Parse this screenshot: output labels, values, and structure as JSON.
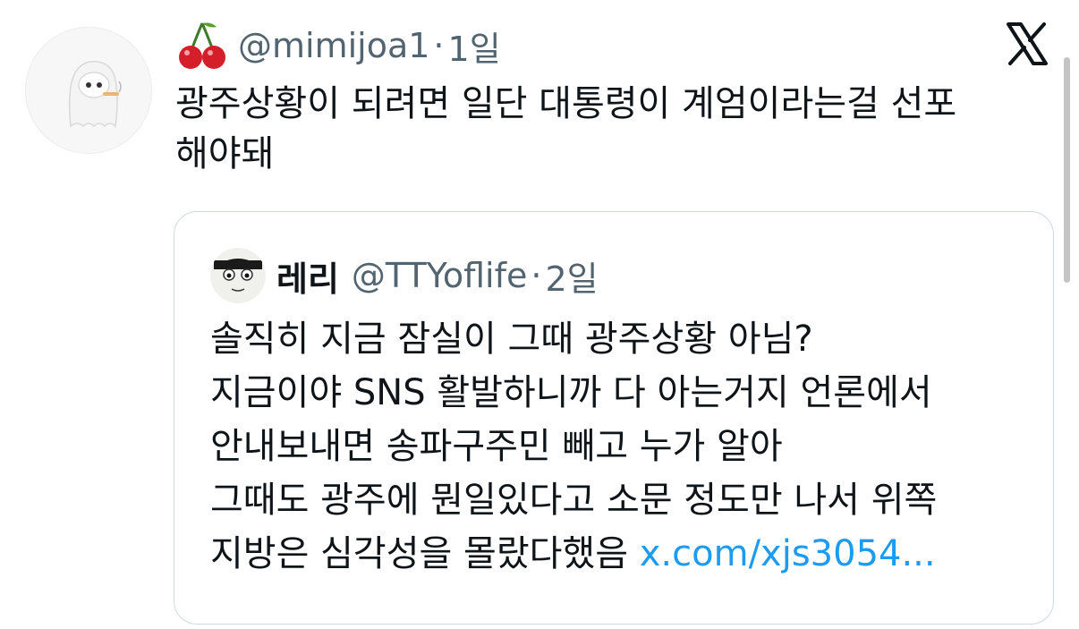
{
  "tweet": {
    "author_handle": "@mimijoa1",
    "separator": "·",
    "time": "1일",
    "text_lines": [
      "광주상황이 되려면 일단 대통령이 계엄이라는걸 선포",
      "해야돼"
    ],
    "avatar_icon": "ghost-avatar-icon",
    "badge_icon": "cherry-icon"
  },
  "platform": {
    "logo_icon": "x-logo-icon"
  },
  "quoted_tweet": {
    "author_name": "레리",
    "author_handle": "@TTYoflife",
    "separator": "·",
    "time": "2일",
    "lines": [
      "솔직히 지금 잠실이 그때 광주상황 아님?",
      "지금이야 SNS 활발하니까 다 아는거지 언론에서",
      "안내보내면 송파구주민 빼고 누가 알아",
      "그때도 광주에 뭔일있다고 소문 정도만 나서 위쪽"
    ],
    "last_line_text": "지방은 심각성을 몰랐다했음 ",
    "last_line_link": "x.com/xjs3054...",
    "link_color": "#1d9bf0"
  }
}
